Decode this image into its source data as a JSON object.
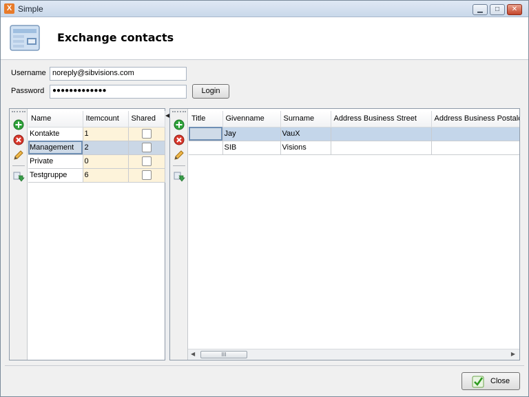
{
  "window": {
    "app_icon_glyph": "X",
    "title": "Simple",
    "controls": {
      "minimize": "▁",
      "maximize": "□",
      "close": "✕"
    }
  },
  "banner": {
    "title": "Exchange contacts",
    "icon": "contacts-card-icon"
  },
  "login": {
    "username_label": "Username",
    "username_value": "noreply@sibvisions.com",
    "password_label": "Password",
    "password_value": "●●●●●●●●●●●●●",
    "login_button": "Login"
  },
  "groups": {
    "toolbar": [
      "add-icon",
      "delete-icon",
      "edit-icon",
      "export-icon"
    ],
    "columns": [
      "Name",
      "Itemcount",
      "Shared"
    ],
    "rows": [
      {
        "name": "Kontakte",
        "itemcount": "1",
        "shared": false
      },
      {
        "name": "Management",
        "itemcount": "2",
        "shared": false
      },
      {
        "name": "Private",
        "itemcount": "0",
        "shared": false
      },
      {
        "name": "Testgruppe",
        "itemcount": "6",
        "shared": false
      }
    ]
  },
  "contacts": {
    "toolbar": [
      "add-icon",
      "delete-icon",
      "edit-icon",
      "export-icon"
    ],
    "columns": [
      "Title",
      "Givenname",
      "Surname",
      "Address Business Street",
      "Address Business Postalcode"
    ],
    "rows": [
      {
        "title": "",
        "givenname": "Jay",
        "surname": "VauX",
        "street": "",
        "postal": ""
      },
      {
        "title": "",
        "givenname": "SIB",
        "surname": "Visions",
        "street": "",
        "postal": ""
      }
    ],
    "scroll_thumb": "III",
    "scroll_left": "◀",
    "scroll_right": "▶"
  },
  "footer": {
    "close_button": "Close"
  }
}
